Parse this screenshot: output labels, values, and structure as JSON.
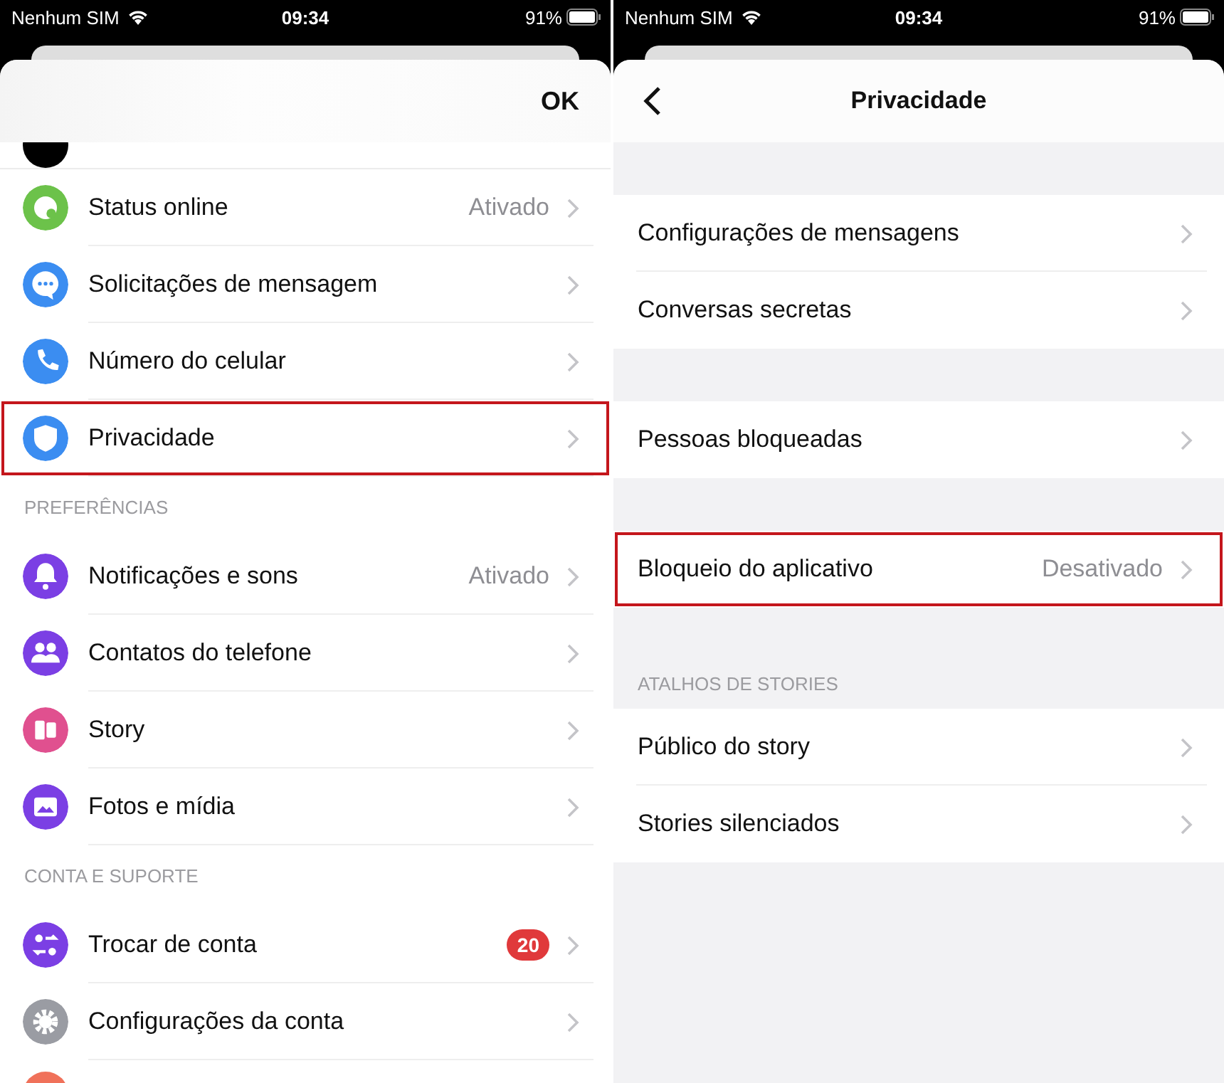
{
  "screens": [
    {
      "status_bar": {
        "carrier": "Nenhum SIM",
        "time": "09:34",
        "battery": "91%"
      },
      "header": {
        "kind": "sheet",
        "action": "OK"
      },
      "clipped_top": {
        "color": "#000000"
      },
      "sections": [
        {
          "rows": [
            {
              "label": "Status online",
              "value": "Ativado",
              "color": "#6cc24a",
              "highlighted": false
            },
            {
              "label": "Solicitações de mensagem",
              "color": "#3b8df1",
              "highlighted": false
            },
            {
              "label": "Número do celular",
              "color": "#3b8df1",
              "highlighted": false
            },
            {
              "label": "Privacidade",
              "color": "#3b8df1",
              "highlighted": true
            }
          ]
        },
        {
          "title": "PREFERÊNCIAS",
          "rows": [
            {
              "label": "Notificações e sons",
              "value": "Ativado",
              "color": "#7b3fe4",
              "highlighted": false
            },
            {
              "label": "Contatos do telefone",
              "color": "#7b3fe4",
              "highlighted": false
            },
            {
              "label": "Story",
              "color": "#e0508f",
              "highlighted": false
            },
            {
              "label": "Fotos e mídia",
              "color": "#7b3fe4",
              "highlighted": false
            }
          ]
        },
        {
          "title": "CONTA E SUPORTE",
          "rows": [
            {
              "label": "Trocar de conta",
              "badge": "20",
              "color": "#7b3fe4",
              "highlighted": false
            },
            {
              "label": "Configurações da conta",
              "color": "#9a9ca3",
              "highlighted": false
            }
          ]
        }
      ],
      "clipped_bottom": {
        "color": "#f0715a"
      }
    },
    {
      "status_bar": {
        "carrier": "Nenhum SIM",
        "time": "09:34",
        "battery": "91%"
      },
      "header": {
        "kind": "nav",
        "title": "Privacidade"
      },
      "sections": [
        {
          "rows": [
            {
              "label": "Configurações de mensagens",
              "highlighted": false
            },
            {
              "label": "Conversas secretas",
              "highlighted": false
            }
          ]
        },
        {
          "rows": [
            {
              "label": "Pessoas bloqueadas",
              "highlighted": false
            }
          ]
        },
        {
          "rows": [
            {
              "label": "Bloqueio do aplicativo",
              "value": "Desativado",
              "highlighted": true
            }
          ]
        },
        {
          "title": "ATALHOS DE STORIES",
          "rows": [
            {
              "label": "Público do story",
              "highlighted": false
            },
            {
              "label": "Stories silenciados",
              "highlighted": false
            }
          ]
        }
      ]
    }
  ]
}
